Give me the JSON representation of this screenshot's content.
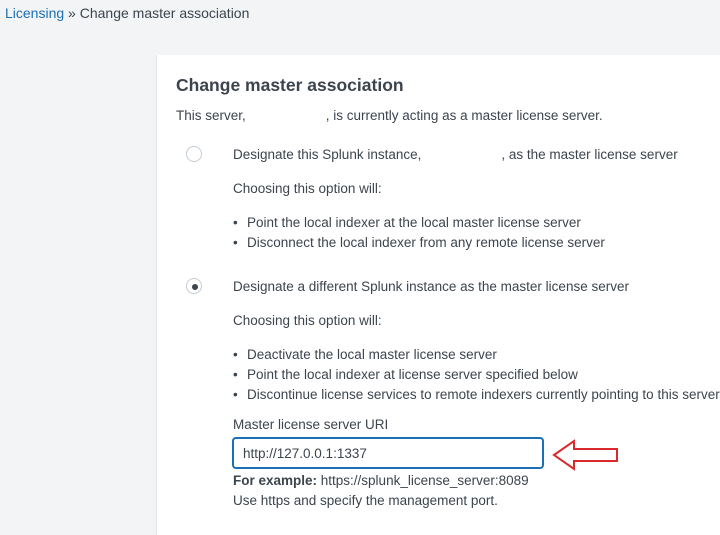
{
  "breadcrumb": {
    "parent": "Licensing",
    "separator": " » ",
    "current": "Change master association"
  },
  "panel": {
    "title": "Change master association",
    "status_prefix": "This server,",
    "status_suffix": ", is currently acting as a master license server.",
    "option_local": {
      "label_prefix": "Designate this Splunk instance,",
      "label_suffix": ", as the master license server",
      "selected": false,
      "choosing_text": "Choosing this option will:",
      "bullets": [
        "Point the local indexer at the local master license server",
        "Disconnect the local indexer from any remote license server"
      ]
    },
    "option_remote": {
      "label": "Designate a different Splunk instance as the master license server",
      "selected": true,
      "choosing_text": "Choosing this option will:",
      "bullets": [
        "Deactivate the local master license server",
        "Point the local indexer at license server specified below",
        "Discontinue license services to remote indexers currently pointing to this server"
      ]
    },
    "uri": {
      "label": "Master license server URI",
      "value": "http://127.0.0.1:1337",
      "example_label": "For example:",
      "example_value": " https://splunk_license_server:8089",
      "hint": "Use https and specify the management port."
    }
  },
  "annotation": {
    "icon": "red-arrow-left-icon",
    "color": "#d92b2b"
  }
}
